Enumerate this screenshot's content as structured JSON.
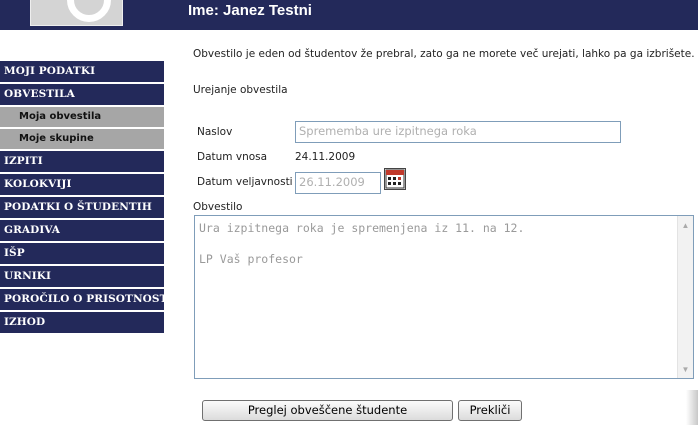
{
  "header": {
    "user_name": "Ime: Janez Testni"
  },
  "sidebar": {
    "items": [
      {
        "label": "MOJI PODATKI"
      },
      {
        "label": "OBVESTILA"
      },
      {
        "label": "Moja obvestila",
        "sub": true
      },
      {
        "label": "Moje skupine",
        "sub": true
      },
      {
        "label": "IZPITI"
      },
      {
        "label": "KOLOKVIJI"
      },
      {
        "label": "PODATKI O ŠTUDENTIH"
      },
      {
        "label": "GRADIVA"
      },
      {
        "label": "IŠP"
      },
      {
        "label": "URNIKI"
      },
      {
        "label": "POROČILO O PRISOTNOSTI"
      },
      {
        "label": "IZHOD"
      }
    ]
  },
  "main": {
    "notice": "Obvestilo je eden od študentov že prebral, zato ga ne morete več urejati, lahko pa ga izbrišete.",
    "section_title": "Urejanje obvestila",
    "form": {
      "naslov_label": "Naslov",
      "naslov_value": "Sprememba ure izpitnega roka",
      "datum_vnosa_label": "Datum vnosa",
      "datum_vnosa_value": "24.11.2009",
      "datum_veljavnosti_label": "Datum veljavnosti",
      "datum_veljavnosti_value": "26.11.2009",
      "obvestilo_label": "Obvestilo",
      "obvestilo_line1": "Ura izpitnega roka je spremenjena iz 11. na 12.",
      "obvestilo_line2": "LP Vaš profesor"
    },
    "buttons": {
      "preglej": "Preglej obveščene študente",
      "preklici": "Prekliči"
    }
  },
  "icons": {
    "calendar": "calendar-icon",
    "scroll_up": "scroll-up-arrow-icon",
    "scroll_down": "scroll-down-arrow-icon"
  },
  "colors": {
    "nav_bg": "#23295a",
    "sub_nav_bg": "#a6a6a6",
    "input_border": "#7f9db9"
  }
}
